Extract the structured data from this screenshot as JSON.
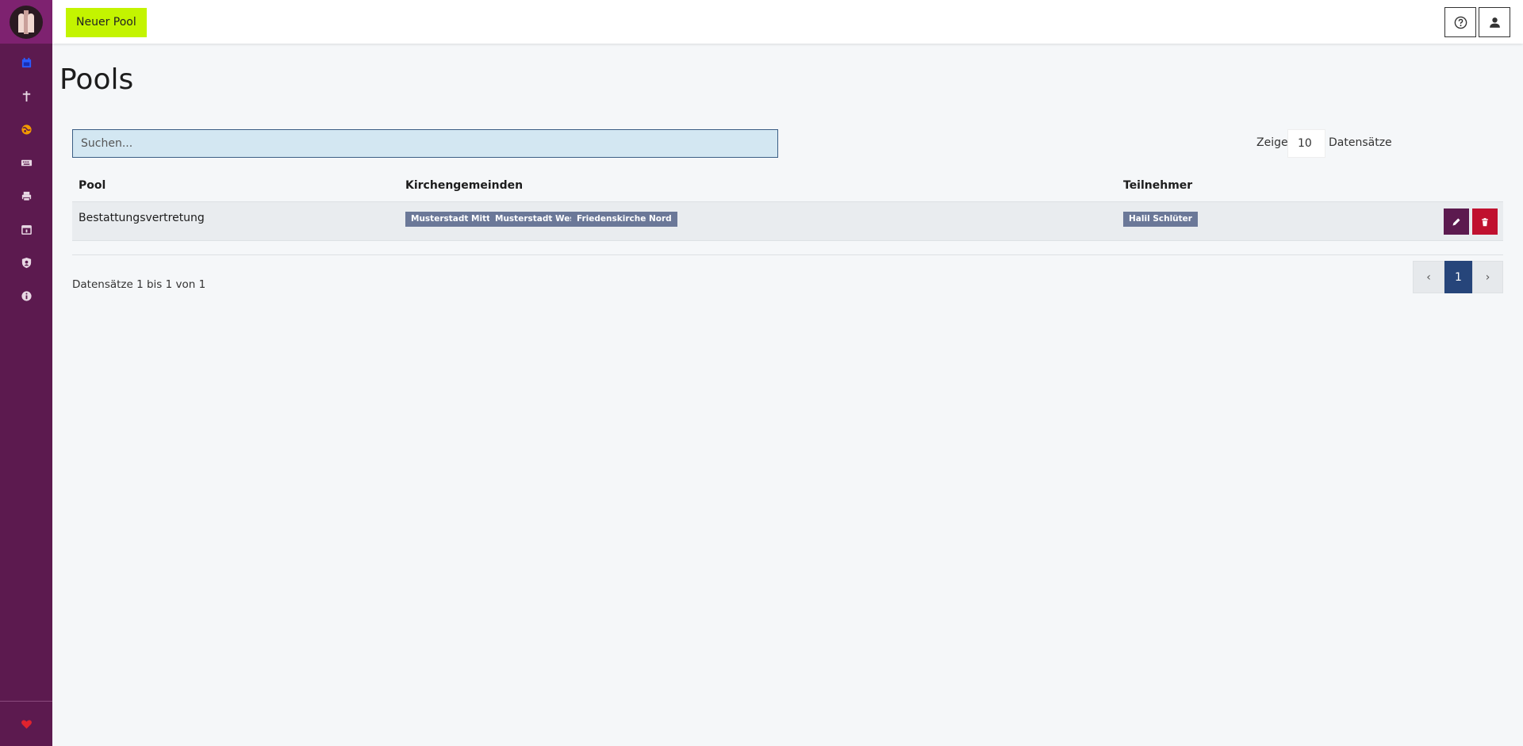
{
  "topbar": {
    "new_pool_label": "Neuer Pool"
  },
  "page": {
    "title": "Pools"
  },
  "search": {
    "placeholder": "Suchen..."
  },
  "length_menu": {
    "prefix": "Zeige",
    "value": "10",
    "suffix": "Datensätze"
  },
  "table": {
    "columns": [
      "Pool",
      "Kirchengemeinden",
      "Teilnehmer"
    ],
    "rows": [
      {
        "pool": "Bestattungsvertretung",
        "kirchengemeinden": [
          "Musterstadt Mitte",
          "Musterstadt West",
          "Friedenskirche Nord"
        ],
        "teilnehmer": [
          "Halil Schlüter"
        ]
      }
    ]
  },
  "info": "Datensätze 1 bis 1 von 1",
  "pagination": {
    "prev": "‹",
    "current": "1",
    "next": "›"
  },
  "colors": {
    "sidebar": "#5c1a4f",
    "accent_button": "#c3f400",
    "badge": "#6b7898",
    "edit": "#5c1a4f",
    "delete": "#c0112f",
    "active_page": "#26457a"
  },
  "icons": {
    "sidebar": [
      "calendar-icon",
      "cross-icon",
      "globe-icon",
      "keyboard-icon",
      "printer-icon",
      "calendar-grid-icon",
      "user-shield-icon",
      "info-icon",
      "heart-icon"
    ],
    "topbar": [
      "help-icon",
      "user-icon"
    ],
    "row_actions": [
      "pencil-icon",
      "trash-icon"
    ]
  }
}
